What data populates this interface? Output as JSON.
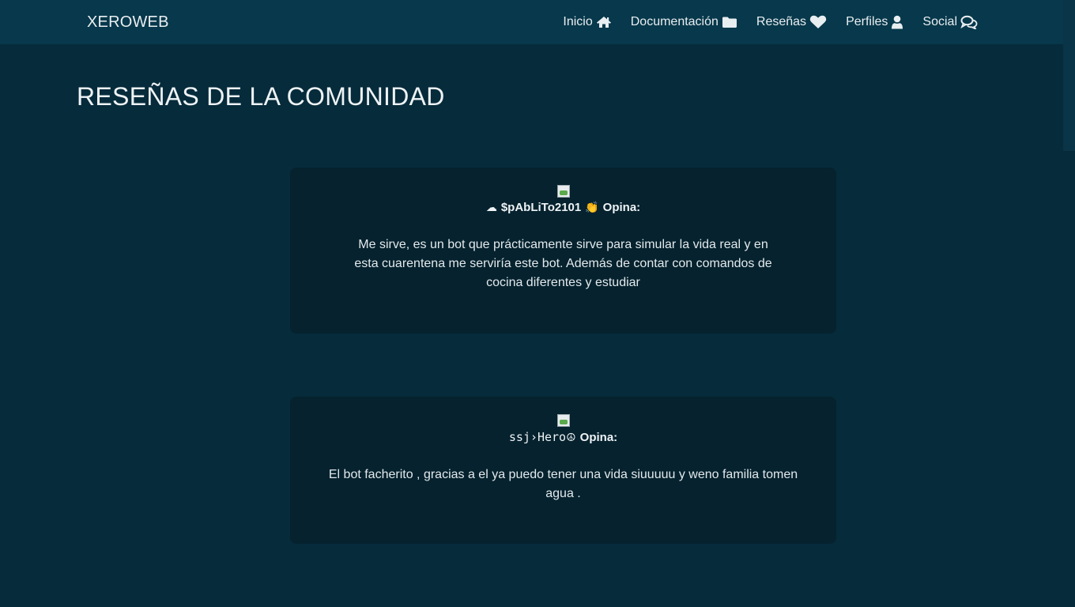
{
  "navbar": {
    "brand": "XEROWEB",
    "links": [
      {
        "label": "Inicio",
        "icon": "home-icon"
      },
      {
        "label": "Documentación",
        "icon": "folder-icon"
      },
      {
        "label": "Reseñas",
        "icon": "heart-icon"
      },
      {
        "label": "Perfiles",
        "icon": "user-icon"
      },
      {
        "label": "Social",
        "icon": "comments-icon"
      }
    ]
  },
  "page": {
    "title": "RESEÑAS DE LA COMUNIDAD"
  },
  "reviews": [
    {
      "prefix_emoji": "☁",
      "author": "$pAbLiTo2101",
      "suffix_emoji": "👏",
      "opina": "Opina:",
      "text": "Me sirve, es un bot que prácticamente sirve para simular la vida real y en esta cuarentena me serviría este bot. Además de contar con comandos de cocina diferentes y estudiar"
    },
    {
      "prefix_emoji": "",
      "author": "ssj›Hero",
      "suffix_emoji": "☮",
      "opina": "Opina:",
      "text": "El bot facherito , gracias a el ya puedo tener una vida siuuuuu y weno familia tomen agua ."
    }
  ],
  "colors": {
    "background": "#062b3b",
    "navbar": "#07384b",
    "card": "#05222e",
    "text": "#e9eef1"
  }
}
